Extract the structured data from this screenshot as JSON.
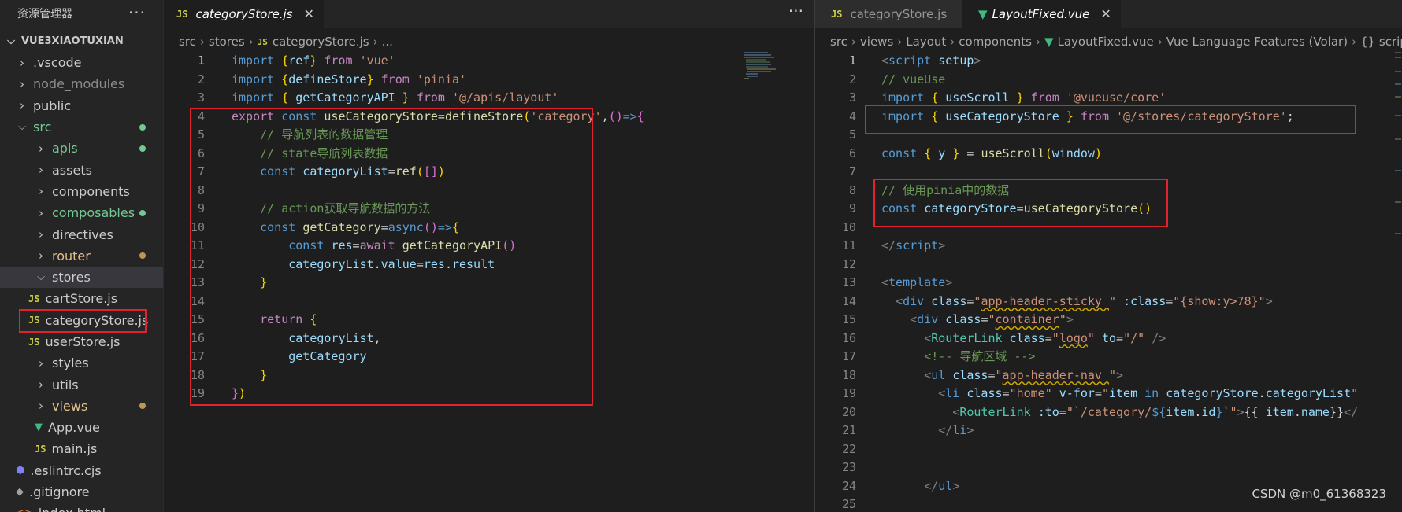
{
  "explorer": {
    "title": "资源管理器",
    "more": "···",
    "root": "VUE3XIAOTUXIAN",
    "items": [
      {
        "label": ".vscode",
        "indent": 1,
        "kind": "folder-closed",
        "color": "#cccccc"
      },
      {
        "label": "node_modules",
        "indent": 1,
        "kind": "folder-closed",
        "color": "#8c8c8c"
      },
      {
        "label": "public",
        "indent": 1,
        "kind": "folder-closed",
        "color": "#cccccc"
      },
      {
        "label": "src",
        "indent": 1,
        "kind": "folder-open",
        "color": "#73c991",
        "dot": "#73c991"
      },
      {
        "label": "apis",
        "indent": 2,
        "kind": "folder-closed",
        "color": "#73c991",
        "dot": "#73c991"
      },
      {
        "label": "assets",
        "indent": 2,
        "kind": "folder-closed",
        "color": "#cccccc"
      },
      {
        "label": "components",
        "indent": 2,
        "kind": "folder-closed",
        "color": "#cccccc"
      },
      {
        "label": "composables",
        "indent": 2,
        "kind": "folder-closed",
        "color": "#73c991",
        "dot": "#73c991"
      },
      {
        "label": "directives",
        "indent": 2,
        "kind": "folder-closed",
        "color": "#cccccc"
      },
      {
        "label": "router",
        "indent": 2,
        "kind": "folder-closed",
        "color": "#e2c08d",
        "dot": "#c09553"
      },
      {
        "label": "stores",
        "indent": 2,
        "kind": "folder-open",
        "color": "#cccccc",
        "selected": true
      },
      {
        "label": "cartStore.js",
        "indent": 3,
        "kind": "js",
        "color": "#cccccc"
      },
      {
        "label": "categoryStore.js",
        "indent": 3,
        "kind": "js",
        "color": "#cccccc",
        "boxed": true
      },
      {
        "label": "userStore.js",
        "indent": 3,
        "kind": "js",
        "color": "#cccccc"
      },
      {
        "label": "styles",
        "indent": 2,
        "kind": "folder-closed",
        "color": "#cccccc"
      },
      {
        "label": "utils",
        "indent": 2,
        "kind": "folder-closed",
        "color": "#cccccc"
      },
      {
        "label": "views",
        "indent": 2,
        "kind": "folder-closed",
        "color": "#e2c08d",
        "dot": "#c09553"
      },
      {
        "label": "App.vue",
        "indent": 2,
        "kind": "vue",
        "color": "#cccccc"
      },
      {
        "label": "main.js",
        "indent": 2,
        "kind": "js",
        "color": "#cccccc"
      },
      {
        "label": ".eslintrc.cjs",
        "indent": 1,
        "kind": "eslint",
        "color": "#cccccc"
      },
      {
        "label": ".gitignore",
        "indent": 1,
        "kind": "git",
        "color": "#cccccc"
      },
      {
        "label": "index.html",
        "indent": 1,
        "kind": "html",
        "color": "#cccccc"
      }
    ]
  },
  "left_editor": {
    "tab": "categoryStore.js",
    "tab_close": "✕",
    "more": "···",
    "breadcrumb": [
      "src",
      "stores",
      "categoryStore.js",
      "..."
    ],
    "lines": [
      [
        [
          "k",
          "import"
        ],
        [
          "pl",
          " "
        ],
        [
          "b",
          "{"
        ],
        [
          "v",
          "ref"
        ],
        [
          "b",
          "}"
        ],
        [
          "pl",
          " "
        ],
        [
          "p",
          "from"
        ],
        [
          "pl",
          " "
        ],
        [
          "s",
          "'vue'"
        ]
      ],
      [
        [
          "k",
          "import"
        ],
        [
          "pl",
          " "
        ],
        [
          "b",
          "{"
        ],
        [
          "v",
          "defineStore"
        ],
        [
          "b",
          "}"
        ],
        [
          "pl",
          " "
        ],
        [
          "p",
          "from"
        ],
        [
          "pl",
          " "
        ],
        [
          "s",
          "'pinia'"
        ]
      ],
      [
        [
          "k",
          "import"
        ],
        [
          "pl",
          " "
        ],
        [
          "b",
          "{"
        ],
        [
          "pl",
          " "
        ],
        [
          "v",
          "getCategoryAPI"
        ],
        [
          "pl",
          " "
        ],
        [
          "b",
          "}"
        ],
        [
          "pl",
          " "
        ],
        [
          "p",
          "from"
        ],
        [
          "pl",
          " "
        ],
        [
          "s",
          "'@/apis/layout'"
        ]
      ],
      [
        [
          "p",
          "export"
        ],
        [
          "pl",
          " "
        ],
        [
          "k",
          "const"
        ],
        [
          "pl",
          " "
        ],
        [
          "f",
          "useCategoryStore"
        ],
        [
          "pl",
          "="
        ],
        [
          "f",
          "defineStore"
        ],
        [
          "b",
          "("
        ],
        [
          "s",
          "'category'"
        ],
        [
          "pl",
          ","
        ],
        [
          "bp",
          "("
        ],
        [
          "bp",
          ")"
        ],
        [
          "k",
          "=>"
        ],
        [
          "bp",
          "{"
        ]
      ],
      [
        [
          "pl",
          "    "
        ],
        [
          "c",
          "// 导航列表的数据管理"
        ]
      ],
      [
        [
          "pl",
          "    "
        ],
        [
          "c",
          "// state导航列表数据"
        ]
      ],
      [
        [
          "pl",
          "    "
        ],
        [
          "k",
          "const"
        ],
        [
          "pl",
          " "
        ],
        [
          "v",
          "categoryList"
        ],
        [
          "pl",
          "="
        ],
        [
          "f",
          "ref"
        ],
        [
          "b",
          "("
        ],
        [
          "bp",
          "[]"
        ],
        [
          "b",
          ")"
        ]
      ],
      [
        [
          "pl",
          ""
        ]
      ],
      [
        [
          "pl",
          "    "
        ],
        [
          "c",
          "// action获取导航数据的方法"
        ]
      ],
      [
        [
          "pl",
          "    "
        ],
        [
          "k",
          "const"
        ],
        [
          "pl",
          " "
        ],
        [
          "f",
          "getCategory"
        ],
        [
          "pl",
          "="
        ],
        [
          "k",
          "async"
        ],
        [
          "bp",
          "("
        ],
        [
          "bp",
          ")"
        ],
        [
          "k",
          "=>"
        ],
        [
          "b",
          "{"
        ]
      ],
      [
        [
          "pl",
          "        "
        ],
        [
          "k",
          "const"
        ],
        [
          "pl",
          " "
        ],
        [
          "v",
          "res"
        ],
        [
          "pl",
          "="
        ],
        [
          "p",
          "await"
        ],
        [
          "pl",
          " "
        ],
        [
          "f",
          "getCategoryAPI"
        ],
        [
          "bp",
          "()"
        ]
      ],
      [
        [
          "pl",
          "        "
        ],
        [
          "v",
          "categoryList"
        ],
        [
          "pl",
          "."
        ],
        [
          "v",
          "value"
        ],
        [
          "pl",
          "="
        ],
        [
          "v",
          "res"
        ],
        [
          "pl",
          "."
        ],
        [
          "v",
          "result"
        ]
      ],
      [
        [
          "pl",
          "    "
        ],
        [
          "b",
          "}"
        ]
      ],
      [
        [
          "pl",
          ""
        ]
      ],
      [
        [
          "pl",
          "    "
        ],
        [
          "p",
          "return"
        ],
        [
          "pl",
          " "
        ],
        [
          "b",
          "{"
        ]
      ],
      [
        [
          "pl",
          "        "
        ],
        [
          "v",
          "categoryList"
        ],
        [
          "pl",
          ","
        ]
      ],
      [
        [
          "pl",
          "        "
        ],
        [
          "v",
          "getCategory"
        ]
      ],
      [
        [
          "pl",
          "    "
        ],
        [
          "b",
          "}"
        ]
      ],
      [
        [
          "bp",
          "}"
        ],
        [
          "b",
          ")"
        ]
      ]
    ]
  },
  "right_editor": {
    "tab_inactive": "categoryStore.js",
    "tab_active": "LayoutFixed.vue",
    "tab_close": "✕",
    "breadcrumb": [
      "src",
      "views",
      "Layout",
      "components",
      "LayoutFixed.vue",
      "Vue Language Features (Volar)",
      "{} script setup"
    ],
    "lines": [
      [
        [
          "tg",
          "<"
        ],
        [
          "k",
          "script"
        ],
        [
          "pl",
          " "
        ],
        [
          "at",
          "setup"
        ],
        [
          "tg",
          ">"
        ]
      ],
      [
        [
          "c",
          "// vueUse"
        ]
      ],
      [
        [
          "k",
          "import"
        ],
        [
          "pl",
          " "
        ],
        [
          "b",
          "{"
        ],
        [
          "pl",
          " "
        ],
        [
          "v",
          "useScroll"
        ],
        [
          "pl",
          " "
        ],
        [
          "b",
          "}"
        ],
        [
          "pl",
          " "
        ],
        [
          "p",
          "from"
        ],
        [
          "pl",
          " "
        ],
        [
          "s",
          "'@vueuse/core'"
        ]
      ],
      [
        [
          "k",
          "import"
        ],
        [
          "pl",
          " "
        ],
        [
          "b",
          "{"
        ],
        [
          "pl",
          " "
        ],
        [
          "v",
          "useCategoryStore"
        ],
        [
          "pl",
          " "
        ],
        [
          "b",
          "}"
        ],
        [
          "pl",
          " "
        ],
        [
          "p",
          "from"
        ],
        [
          "pl",
          " "
        ],
        [
          "s",
          "'@/stores/categoryStore'"
        ],
        [
          "pl",
          ";"
        ]
      ],
      [
        [
          "pl",
          ""
        ]
      ],
      [
        [
          "k",
          "const"
        ],
        [
          "pl",
          " "
        ],
        [
          "b",
          "{"
        ],
        [
          "pl",
          " "
        ],
        [
          "v",
          "y"
        ],
        [
          "pl",
          " "
        ],
        [
          "b",
          "}"
        ],
        [
          "pl",
          " = "
        ],
        [
          "f",
          "useScroll"
        ],
        [
          "b",
          "("
        ],
        [
          "v",
          "window"
        ],
        [
          "b",
          ")"
        ]
      ],
      [
        [
          "pl",
          ""
        ]
      ],
      [
        [
          "c",
          "// 使用pinia中的数据"
        ]
      ],
      [
        [
          "k",
          "const"
        ],
        [
          "pl",
          " "
        ],
        [
          "v",
          "categoryStore"
        ],
        [
          "pl",
          "="
        ],
        [
          "f",
          "useCategoryStore"
        ],
        [
          "b",
          "()"
        ]
      ],
      [
        [
          "pl",
          ""
        ]
      ],
      [
        [
          "tg",
          "</"
        ],
        [
          "k",
          "script"
        ],
        [
          "tg",
          ">"
        ]
      ],
      [
        [
          "pl",
          ""
        ]
      ],
      [
        [
          "tg",
          "<"
        ],
        [
          "k",
          "template"
        ],
        [
          "tg",
          ">"
        ]
      ],
      [
        [
          "pl",
          "  "
        ],
        [
          "tg",
          "<"
        ],
        [
          "k",
          "div"
        ],
        [
          "pl",
          " "
        ],
        [
          "at",
          "class"
        ],
        [
          "pl",
          "="
        ],
        [
          "s",
          "\"app-header-sticky \""
        ],
        [
          "pl",
          " "
        ],
        [
          "at",
          ":class"
        ],
        [
          "pl",
          "="
        ],
        [
          "s",
          "\"{show:y>78}\""
        ],
        [
          "tg",
          ">"
        ]
      ],
      [
        [
          "pl",
          "    "
        ],
        [
          "tg",
          "<"
        ],
        [
          "k",
          "div"
        ],
        [
          "pl",
          " "
        ],
        [
          "at",
          "class"
        ],
        [
          "pl",
          "="
        ],
        [
          "s",
          "\"container\""
        ],
        [
          "tg",
          ">"
        ]
      ],
      [
        [
          "pl",
          "      "
        ],
        [
          "tg",
          "<"
        ],
        [
          "t",
          "RouterLink"
        ],
        [
          "pl",
          " "
        ],
        [
          "at",
          "class"
        ],
        [
          "pl",
          "="
        ],
        [
          "s",
          "\"logo\""
        ],
        [
          "pl",
          " "
        ],
        [
          "at",
          "to"
        ],
        [
          "pl",
          "="
        ],
        [
          "s",
          "\"/\""
        ],
        [
          "pl",
          " "
        ],
        [
          "tg",
          "/>"
        ]
      ],
      [
        [
          "pl",
          "      "
        ],
        [
          "c",
          "<!-- 导航区域 -->"
        ]
      ],
      [
        [
          "pl",
          "      "
        ],
        [
          "tg",
          "<"
        ],
        [
          "k",
          "ul"
        ],
        [
          "pl",
          " "
        ],
        [
          "at",
          "class"
        ],
        [
          "pl",
          "="
        ],
        [
          "s",
          "\"app-header-nav \""
        ],
        [
          "tg",
          ">"
        ]
      ],
      [
        [
          "pl",
          "        "
        ],
        [
          "tg",
          "<"
        ],
        [
          "k",
          "li"
        ],
        [
          "pl",
          " "
        ],
        [
          "at",
          "class"
        ],
        [
          "pl",
          "="
        ],
        [
          "s",
          "\"home\""
        ],
        [
          "pl",
          " "
        ],
        [
          "at",
          "v-for"
        ],
        [
          "pl",
          "="
        ],
        [
          "s",
          "\""
        ],
        [
          "v",
          "item"
        ],
        [
          "pl",
          " "
        ],
        [
          "k",
          "in"
        ],
        [
          "pl",
          " "
        ],
        [
          "v",
          "categoryStore"
        ],
        [
          "pl",
          "."
        ],
        [
          "v",
          "categoryList"
        ],
        [
          "s",
          "\""
        ]
      ],
      [
        [
          "pl",
          "          "
        ],
        [
          "tg",
          "<"
        ],
        [
          "t",
          "RouterLink"
        ],
        [
          "pl",
          " "
        ],
        [
          "at",
          ":to"
        ],
        [
          "pl",
          "="
        ],
        [
          "s",
          "\"`/category/"
        ],
        [
          "k",
          "${"
        ],
        [
          "v",
          "item"
        ],
        [
          "pl",
          "."
        ],
        [
          "v",
          "id"
        ],
        [
          "k",
          "}"
        ],
        [
          "s",
          "`\""
        ],
        [
          "tg",
          ">"
        ],
        [
          "pl",
          "{{ "
        ],
        [
          "v",
          "item"
        ],
        [
          "pl",
          "."
        ],
        [
          "v",
          "name"
        ],
        [
          "pl",
          "}}"
        ],
        [
          "tg",
          "</"
        ]
      ],
      [
        [
          "pl",
          "        "
        ],
        [
          "tg",
          "</"
        ],
        [
          "k",
          "li"
        ],
        [
          "tg",
          ">"
        ]
      ],
      [
        [
          "pl",
          ""
        ]
      ],
      [
        [
          "pl",
          ""
        ]
      ],
      [
        [
          "pl",
          "      "
        ],
        [
          "tg",
          "</"
        ],
        [
          "k",
          "ul"
        ],
        [
          "tg",
          ">"
        ]
      ],
      [
        [
          "pl",
          ""
        ]
      ]
    ]
  },
  "watermark": "CSDN @m0_61368323",
  "colors": {
    "redbox": "#e0242f",
    "accent_vue": "#41b883",
    "js_icon": "#cbcb41"
  }
}
